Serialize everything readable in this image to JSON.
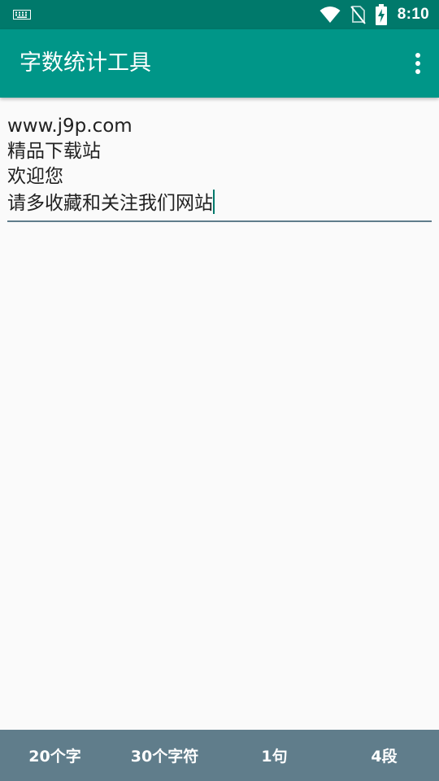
{
  "status_bar": {
    "time": "8:10",
    "icons": [
      "keyboard-icon",
      "wifi-icon",
      "no-sim-icon",
      "battery-charging-icon"
    ]
  },
  "app_bar": {
    "title": "字数统计工具",
    "menu_icon": "more-vert-icon"
  },
  "editor": {
    "lines": [
      "www.j9p.com",
      "精品下载站",
      "欢迎您",
      "请多收藏和关注我们网站"
    ]
  },
  "stats": {
    "chars": "20个字",
    "characters": "30个字符",
    "sentences": "1句",
    "paragraphs": "4段"
  },
  "colors": {
    "status_bar": "#00796b",
    "app_bar": "#009688",
    "bottom_bar": "#607d8b",
    "background": "#fafafa",
    "text": "#212121"
  }
}
